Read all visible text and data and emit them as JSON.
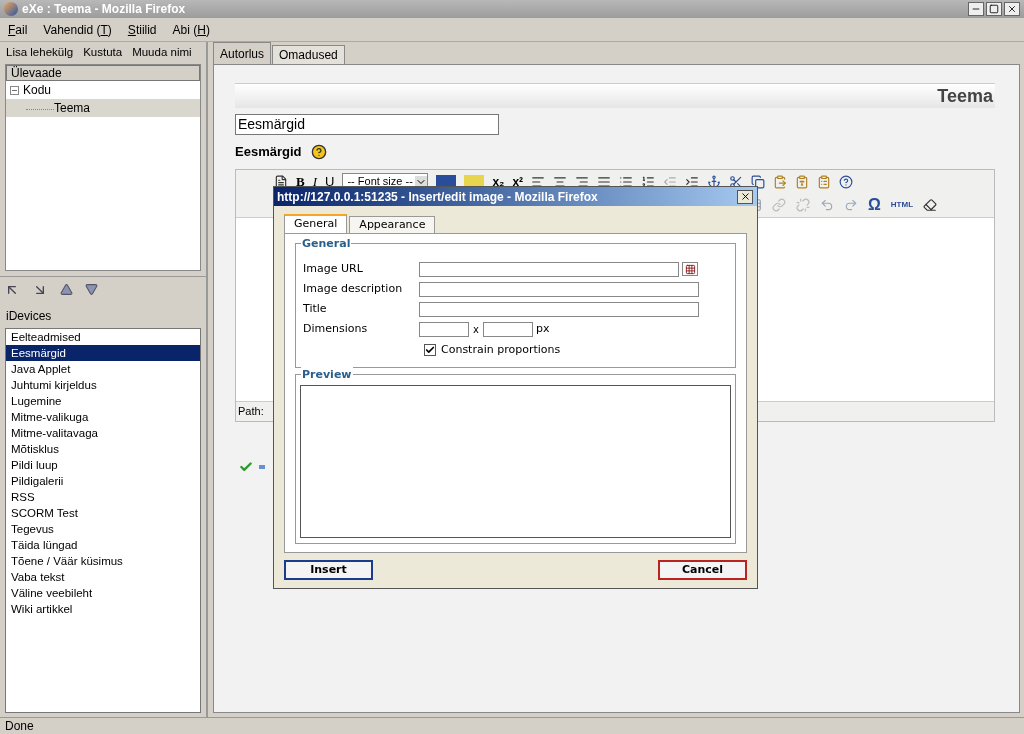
{
  "window": {
    "title": "eXe : Teema - Mozilla Firefox"
  },
  "menu": [
    {
      "key": "F",
      "post": "ail"
    },
    {
      "pre": "Vahendid (",
      "key": "T",
      "post": ")"
    },
    {
      "key": "S",
      "post": "tiilid"
    },
    {
      "pre": "Abi (",
      "key": "H",
      "post": ")"
    }
  ],
  "outline_toolbar": [
    "Lisa lehekülg",
    "Kustuta",
    "Muuda nimi"
  ],
  "outline": {
    "header": "Ülevaade",
    "tree": [
      {
        "label": "Kodu",
        "expanded": true,
        "selected": false,
        "children": [
          {
            "label": "Teema",
            "selected": true
          }
        ]
      }
    ]
  },
  "idevices": {
    "label": "iDevices",
    "items": [
      {
        "label": "Eelteadmised",
        "selected": false
      },
      {
        "label": "Eesmärgid",
        "selected": true
      },
      {
        "label": "Java Applet",
        "selected": false
      },
      {
        "label": "Juhtumi kirjeldus",
        "selected": false
      },
      {
        "label": "Lugemine",
        "selected": false
      },
      {
        "label": "Mitme-valikuga",
        "selected": false
      },
      {
        "label": "Mitme-valitavaga",
        "selected": false
      },
      {
        "label": "Mõtisklus",
        "selected": false
      },
      {
        "label": "Pildi luup",
        "selected": false
      },
      {
        "label": "Pildigalerii",
        "selected": false
      },
      {
        "label": "RSS",
        "selected": false
      },
      {
        "label": "SCORM Test",
        "selected": false
      },
      {
        "label": "Tegevus",
        "selected": false
      },
      {
        "label": "Täida lüngad",
        "selected": false
      },
      {
        "label": "Tõene / Väär küsimus",
        "selected": false
      },
      {
        "label": "Vaba tekst",
        "selected": false
      },
      {
        "label": "Väline veebileht",
        "selected": false
      },
      {
        "label": "Wiki artikkel",
        "selected": false
      }
    ]
  },
  "tabs": [
    {
      "label": "Autorlus",
      "selected": true
    },
    {
      "label": "Omadused",
      "selected": false
    }
  ],
  "page": {
    "title": "Teema",
    "title_field": {
      "value": "Eesmärgid"
    },
    "section_label": "Eesmärgid",
    "editor": {
      "font_size": "-- Font size --",
      "bold": "B",
      "italic": "I",
      "underline": "U",
      "subscript": "x₂",
      "superscript": "x²",
      "omega": "Ω",
      "html": "HTML",
      "path_label": "Path:"
    }
  },
  "dialog": {
    "title": "http://127.0.0.1:51235 - Insert/edit image - Mozilla Firefox",
    "tabs": [
      {
        "label": "General",
        "selected": true
      },
      {
        "label": "Appearance",
        "selected": false
      }
    ],
    "general_legend": "General",
    "fields": [
      {
        "label": "Image URL",
        "kind": "url"
      },
      {
        "label": "Image description",
        "kind": "text"
      },
      {
        "label": "Title",
        "kind": "text"
      }
    ],
    "dimensions": {
      "label": "Dimensions",
      "separator": "x",
      "unit": "px"
    },
    "constrain": {
      "label": "Constrain proportions",
      "checked": true
    },
    "preview_legend": "Preview",
    "insert": "Insert",
    "cancel": "Cancel"
  },
  "status_bar": "Done"
}
